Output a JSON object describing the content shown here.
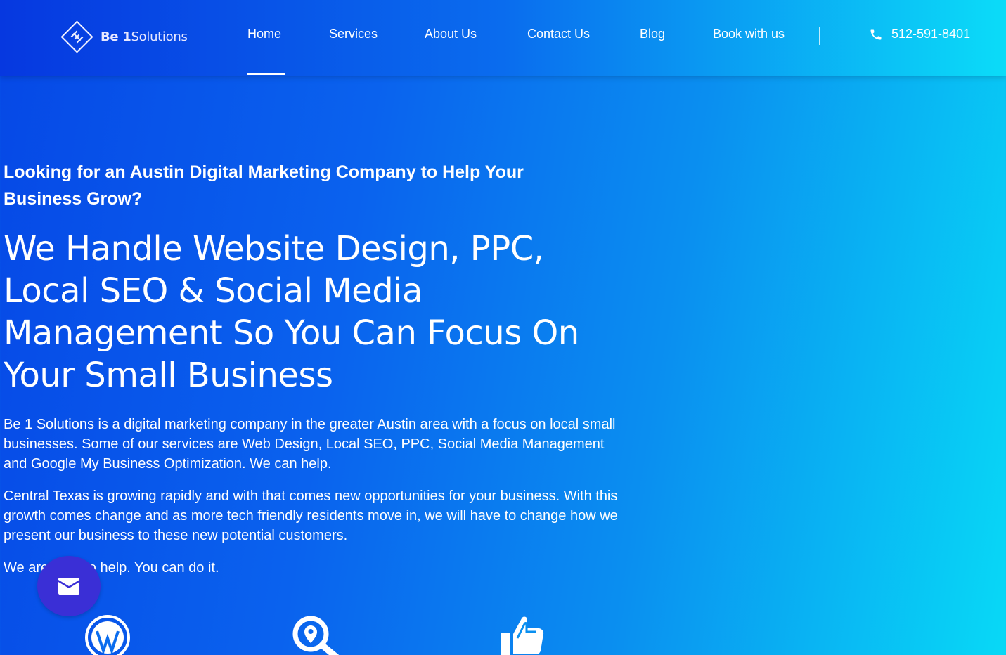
{
  "brand": {
    "logo_prefix": "Be 1",
    "logo_suffix": "Solutions"
  },
  "nav": {
    "items": [
      {
        "label": "Home",
        "active": true
      },
      {
        "label": "Services"
      },
      {
        "label": "About Us"
      },
      {
        "label": "Contact Us"
      },
      {
        "label": "Blog"
      },
      {
        "label": "Book with us"
      }
    ],
    "phone": "512-591-8401"
  },
  "hero": {
    "subhead": "Looking for an Austin Digital Marketing Company to Help Your Business Grow?",
    "headline": "We Handle Website Design, PPC, Local SEO & Social Media Management So You Can Focus On Your Small Business",
    "paragraph_1": "Be 1 Solutions is a digital marketing company in the greater Austin area with a focus on local small businesses. Some of our services are Web Design, Local SEO, PPC, Social Media Management and Google My Business Optimization. We can help.",
    "paragraph_2": "Central Texas is growing rapidly and with that comes new opportunities for your business. With this growth comes change and as more tech friendly residents move in, we will have to change how we present our business to these new potential customers.",
    "paragraph_3": "We are here to help. You can do it."
  },
  "colors": {
    "header_start": "#0638e0",
    "header_end": "#0bdcf8",
    "fab": "#3a2fd6"
  },
  "icons": [
    "phone-icon",
    "mail-icon",
    "wordpress-icon",
    "seo-search-icon",
    "thumbs-up-icon"
  ]
}
